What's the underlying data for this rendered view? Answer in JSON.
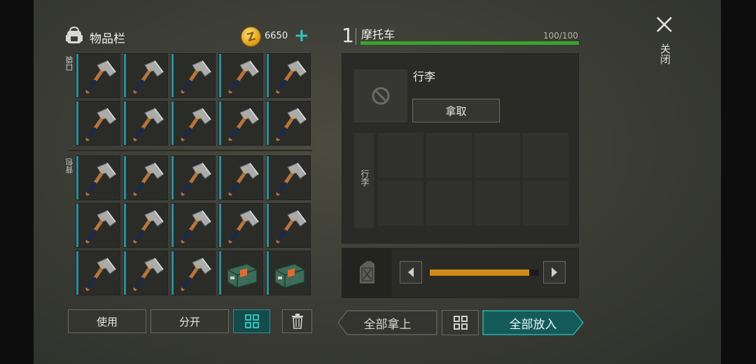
{
  "inventory": {
    "title": "物品栏",
    "currency": {
      "amount": "6650",
      "icon": "gold-coin-icon",
      "add_icon": "plus-icon"
    },
    "pocket_label": "口袋",
    "backpack_label": "背包",
    "pocket_slots": [
      "hatchet",
      "hatchet",
      "hatchet",
      "hatchet",
      "hatchet",
      "hatchet",
      "hatchet",
      "hatchet",
      "hatchet",
      "hatchet"
    ],
    "backpack_slots": [
      "hatchet",
      "hatchet",
      "hatchet",
      "hatchet",
      "hatchet",
      "hatchet",
      "hatchet",
      "hatchet",
      "hatchet",
      "hatchet",
      "hatchet",
      "hatchet",
      "hatchet",
      "explosive-pack",
      "explosive-pack"
    ],
    "buttons": {
      "use": "使用",
      "split": "分开"
    }
  },
  "vehicle": {
    "slot_number": "1",
    "name": "摩托车",
    "capacity_text": "100/100",
    "capacity_fraction": 1.0,
    "luggage": {
      "title": "行李",
      "take_button": "拿取",
      "side_label": "行李",
      "empty_icon": "no-item-icon"
    },
    "fuel": {
      "icon": "fuel-canister-icon",
      "fraction": 0.91
    },
    "buttons": {
      "take_all": "全部拿上",
      "put_all": "全部放入"
    }
  },
  "close": {
    "label": "关闭",
    "icon": "close-icon"
  },
  "colors": {
    "accent": "#2fc3c0",
    "health": "#3aa32c",
    "fuel": "#d08a1a"
  }
}
